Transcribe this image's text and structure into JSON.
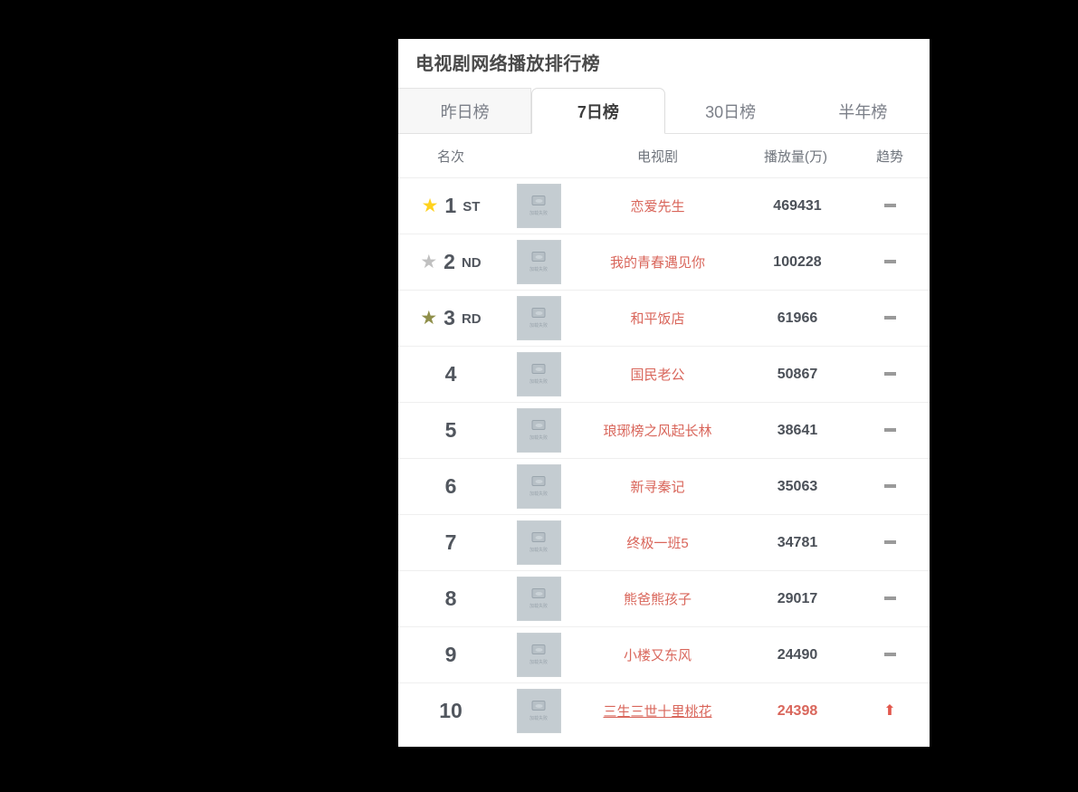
{
  "panel": {
    "title": "电视剧网络播放排行榜"
  },
  "tabs": {
    "items": [
      {
        "label": "昨日榜",
        "active": false
      },
      {
        "label": "7日榜",
        "active": true
      },
      {
        "label": "30日榜",
        "active": false
      },
      {
        "label": "半年榜",
        "active": false
      }
    ]
  },
  "table": {
    "headers": [
      "名次",
      "",
      "电视剧",
      "播放量(万)",
      "趋势"
    ],
    "rows": [
      {
        "rank": "1",
        "rank_suffix": "st",
        "star": "gold",
        "thumb_alt": "加载失败",
        "title": "恋爱先生",
        "plays": "469431",
        "trend": "flat",
        "hot": false,
        "underlined": false
      },
      {
        "rank": "2",
        "rank_suffix": "nd",
        "star": "silver",
        "thumb_alt": "加载失败",
        "title": "我的青春遇见你",
        "plays": "100228",
        "trend": "flat",
        "hot": false,
        "underlined": false
      },
      {
        "rank": "3",
        "rank_suffix": "rd",
        "star": "bronze",
        "thumb_alt": "加载失败",
        "title": "和平饭店",
        "plays": "61966",
        "trend": "flat",
        "hot": false,
        "underlined": false
      },
      {
        "rank": "4",
        "rank_suffix": "",
        "star": "none",
        "thumb_alt": "加载失败",
        "title": "国民老公",
        "plays": "50867",
        "trend": "flat",
        "hot": false,
        "underlined": false
      },
      {
        "rank": "5",
        "rank_suffix": "",
        "star": "none",
        "thumb_alt": "加载失败",
        "title": "琅琊榜之风起长林",
        "plays": "38641",
        "trend": "flat",
        "hot": false,
        "underlined": false
      },
      {
        "rank": "6",
        "rank_suffix": "",
        "star": "none",
        "thumb_alt": "加载失败",
        "title": "新寻秦记",
        "plays": "35063",
        "trend": "flat",
        "hot": false,
        "underlined": false
      },
      {
        "rank": "7",
        "rank_suffix": "",
        "star": "none",
        "thumb_alt": "加载失败",
        "title": "终极一班5",
        "plays": "34781",
        "trend": "flat",
        "hot": false,
        "underlined": false
      },
      {
        "rank": "8",
        "rank_suffix": "",
        "star": "none",
        "thumb_alt": "加载失败",
        "title": "熊爸熊孩子",
        "plays": "29017",
        "trend": "flat",
        "hot": false,
        "underlined": false
      },
      {
        "rank": "9",
        "rank_suffix": "",
        "star": "none",
        "thumb_alt": "加载失败",
        "title": "小楼又东风",
        "plays": "24490",
        "trend": "flat",
        "hot": false,
        "underlined": false
      },
      {
        "rank": "10",
        "rank_suffix": "",
        "star": "none",
        "thumb_alt": "加载失败",
        "title": "三生三世十里桃花",
        "plays": "24398",
        "trend": "up",
        "hot": true,
        "underlined": true
      }
    ]
  },
  "colors": {
    "accent_title": "#d9665b",
    "star_gold": "#ffd21e",
    "star_silver": "#c0c0c0",
    "star_bronze": "#8f8f4a",
    "trend_up": "#e2574c",
    "trend_flat": "#9a9a9a",
    "text_dark": "#4b5058",
    "page_background": "#000000"
  },
  "icons": {
    "star": "★",
    "trend_up": "⬆",
    "trend_flat": "−",
    "broken_image": "broken-image-placeholder"
  }
}
